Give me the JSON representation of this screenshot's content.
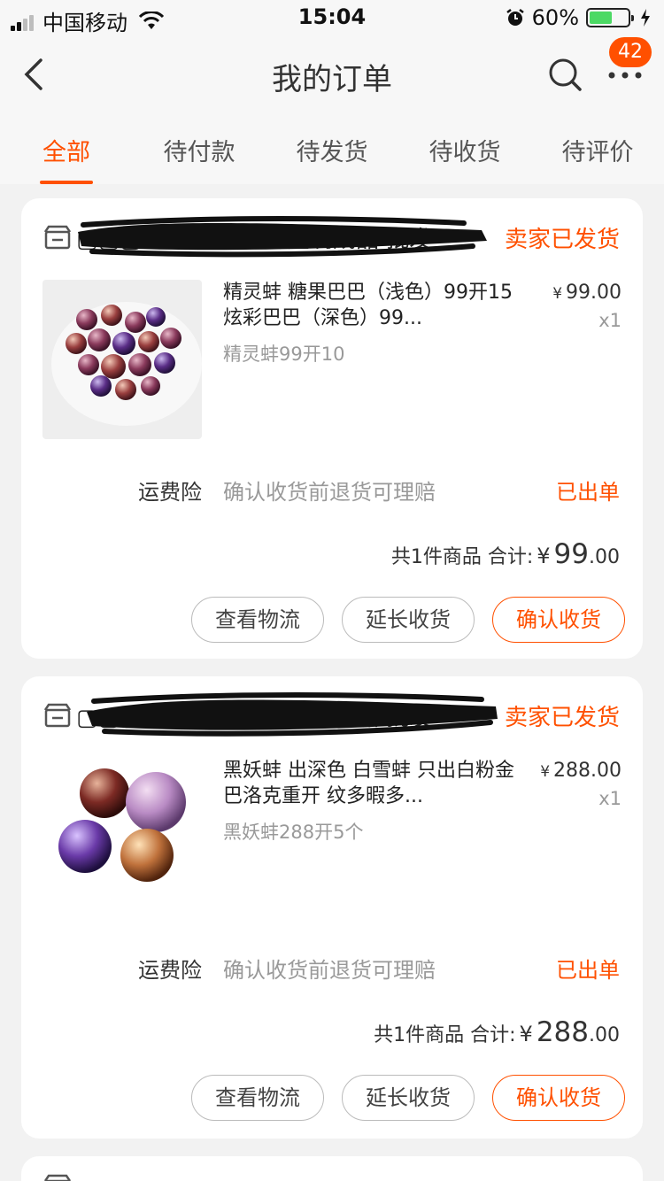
{
  "status_bar": {
    "carrier": "中国移动",
    "time": "15:04",
    "battery_percent": "60%",
    "battery_level": 0.6
  },
  "nav": {
    "title": "我的订单",
    "badge_count": "42"
  },
  "tabs": [
    {
      "label": "全部",
      "active": true
    },
    {
      "label": "待付款",
      "active": false
    },
    {
      "label": "待发货",
      "active": false
    },
    {
      "label": "待收货",
      "active": false
    },
    {
      "label": "待评价",
      "active": false
    }
  ],
  "orders": [
    {
      "shop_name": "▢▢▢珍珠 活体开蚌定制成品 批发",
      "status": "卖家已发货",
      "item_title": "精灵蚌 糖果巴巴（浅色）99开15 炫彩巴巴（深色）99...",
      "item_sku": "精灵蚌99开10",
      "price_symbol": "¥",
      "price": "99.00",
      "qty": "x1",
      "insurance_label": "运费险",
      "insurance_desc": "确认收货前退货可理赔",
      "insurance_status": "已出单",
      "total_prefix": "共1件商品 合计:",
      "total_symbol": "¥",
      "total_int": "99",
      "total_dec": ".00",
      "buttons": [
        "查看物流",
        "延长收货",
        "确认收货"
      ]
    },
    {
      "shop_name": "▢▢▢珍珠 活体开蚌定制成品 批发",
      "status": "卖家已发货",
      "item_title": "黑妖蚌 出深色 白雪蚌 只出白粉金 巴洛克重开 纹多暇多...",
      "item_sku": "黑妖蚌288开5个",
      "price_symbol": "¥",
      "price": "288.00",
      "qty": "x1",
      "insurance_label": "运费险",
      "insurance_desc": "确认收货前退货可理赔",
      "insurance_status": "已出单",
      "total_prefix": "共1件商品 合计:",
      "total_symbol": "¥",
      "total_int": "288",
      "total_dec": ".00",
      "buttons": [
        "查看物流",
        "延长收货",
        "确认收货"
      ]
    }
  ],
  "colors": {
    "accent": "#ff5000",
    "background": "#f2f2f2"
  }
}
